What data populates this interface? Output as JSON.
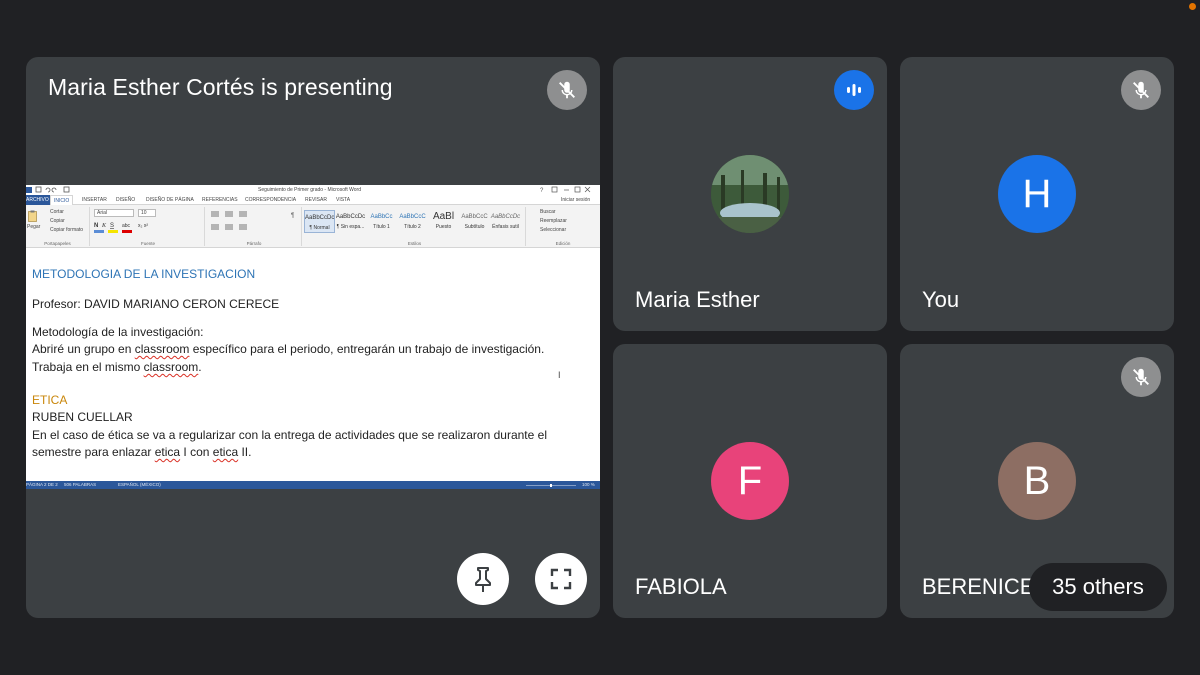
{
  "presenter": {
    "title": "Maria Esther Cortés is presenting",
    "shared_window": {
      "title": "Seguimiento de Primer grado - Microsoft Word",
      "sign_in": "Iniciar sesión",
      "tabs": [
        "ARCHIVO",
        "INICIO",
        "INSERTAR",
        "DISEÑO",
        "DISEÑO DE PÁGINA",
        "REFERENCIAS",
        "CORRESPONDENCIA",
        "REVISAR",
        "VISTA"
      ],
      "clipboard": {
        "cut": "Cortar",
        "copy": "Copiar",
        "format_painter": "Copiar formato",
        "paste": "Pegar",
        "group": "Portapapeles"
      },
      "font": {
        "name": "Arial",
        "size": "10",
        "group": "Fuente"
      },
      "paragraph_group": "Párrafo",
      "styles": {
        "group": "Estilos",
        "items": [
          {
            "preview": "AaBbCcDc",
            "name": "¶ Normal"
          },
          {
            "preview": "AaBbCcDc",
            "name": "¶ Sin espa..."
          },
          {
            "preview": "AaBbCc",
            "name": "Título 1"
          },
          {
            "preview": "AaBbCcC",
            "name": "Título 2"
          },
          {
            "preview": "AaBl",
            "name": "Puesto"
          },
          {
            "preview": "AaBbCcC",
            "name": "Subtítulo"
          },
          {
            "preview": "AaBbCcDc",
            "name": "Énfasis sutil"
          }
        ]
      },
      "editing": {
        "find": "Buscar",
        "replace": "Reemplazar",
        "select": "Seleccionar",
        "group": "Edición"
      },
      "document": {
        "heading1": "METODOLOGIA DE LA INVESTIGACION",
        "professor": "Profesor: DAVID MARIANO CERON CERECE",
        "section_title": "Metodología de la investigación:",
        "p1_a": "Abriré un grupo en ",
        "p1_b": "classroom",
        "p1_c": " específico para el periodo, entregarán un trabajo de investigación.",
        "p2_a": "Trabaja en el mismo ",
        "p2_b": "classroom",
        "p2_c": ".",
        "heading2": "ETICA",
        "teacher2": "RUBEN CUELLAR",
        "p3": "En el caso de ética se va a regularizar con la entrega de actividades que se realizaron durante el",
        "p4_a": "semestre para enlazar ",
        "p4_b": "etica",
        "p4_c": " I con ",
        "p4_d": "etica",
        "p4_e": " II."
      },
      "status": {
        "page": "PÁGINA 2 DE 2",
        "words": "506 PALABRAS",
        "language": "ESPAÑOL (MÉXICO)",
        "zoom": "100 %"
      }
    }
  },
  "participants": [
    {
      "name": "Maria Esther",
      "avatar": "photo",
      "mic": "speaking"
    },
    {
      "name": "You",
      "initial": "H",
      "color": "#1a73e8",
      "mic": "muted"
    },
    {
      "name": "FABIOLA",
      "initial": "F",
      "color": "#e8437a",
      "mic": "none"
    },
    {
      "name": "BERENICE",
      "initial": "B",
      "color": "#8d6e63",
      "mic": "muted"
    }
  ],
  "others_label": "35 others",
  "colors": {
    "background": "#202124",
    "tile": "#3c4043",
    "accent": "#1a73e8"
  }
}
